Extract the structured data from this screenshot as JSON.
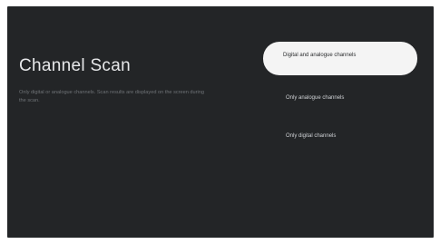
{
  "screen": {
    "title": "Channel Scan",
    "description": "Only digital or analogue channels. Scan results are displayed on the screen during the scan.",
    "options": [
      {
        "label": "Digital and analogue channels",
        "selected": true
      },
      {
        "label": "Only analogue channels",
        "selected": false
      },
      {
        "label": "Only digital channels",
        "selected": false
      }
    ]
  },
  "colors": {
    "background": "#232527",
    "selected_bg": "#f4f4f4",
    "title_text": "#e7e8ea",
    "muted_text": "#6f7377"
  }
}
